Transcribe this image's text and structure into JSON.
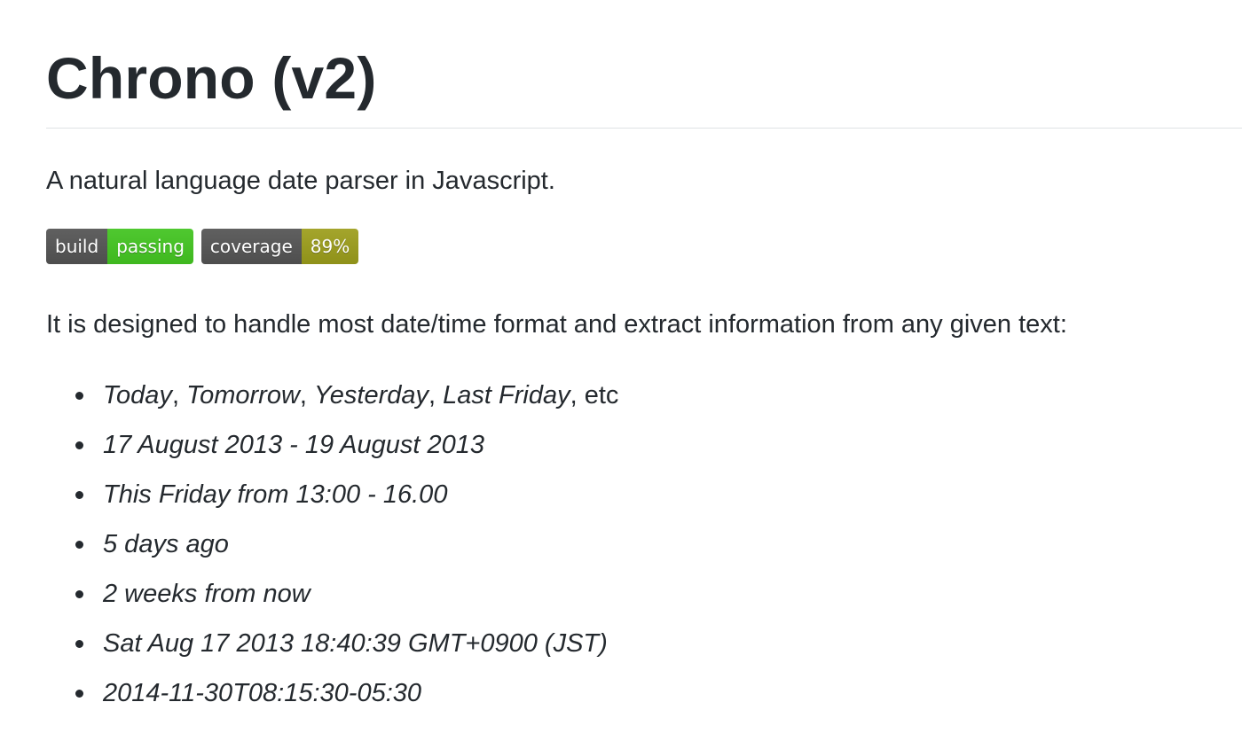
{
  "readme": {
    "title": "Chrono (v2)",
    "tagline": "A natural language date parser in Javascript.",
    "badges": {
      "build": {
        "label": "build",
        "status": "passing",
        "color": "#44cc11"
      },
      "coverage": {
        "label": "coverage",
        "status": "89%",
        "color": "#a4a61d"
      }
    },
    "intro": "It is designed to handle most date/time format and extract information from any given text:",
    "first_item": {
      "today": "Today",
      "sep1": ", ",
      "tomorrow": "Tomorrow",
      "sep2": ", ",
      "yesterday": "Yesterday",
      "sep3": ", ",
      "last_friday": "Last Friday",
      "tail": ", etc"
    },
    "examples": [
      "17 August 2013 - 19 August 2013",
      "This Friday from 13:00 - 16.00",
      "5 days ago",
      "2 weeks from now",
      "Sat Aug 17 2013 18:40:39 GMT+0900 (JST)",
      "2014-11-30T08:15:30-05:30"
    ]
  }
}
